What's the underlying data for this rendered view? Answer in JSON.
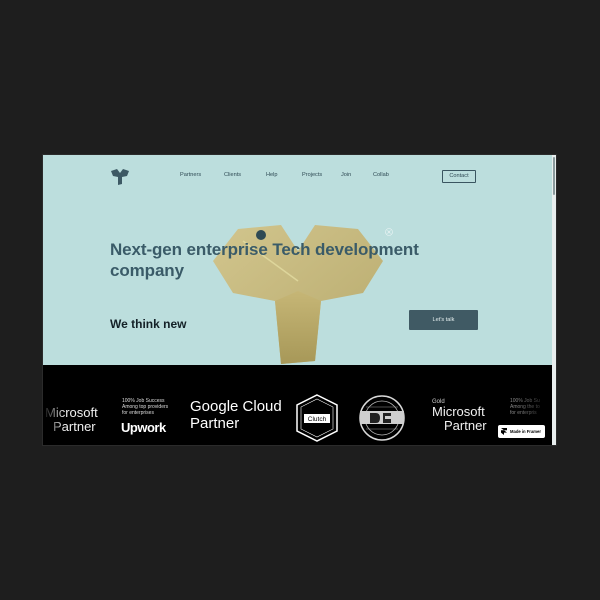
{
  "nav": {
    "items": [
      "Partners",
      "Clients",
      "Help",
      "Projects",
      "Join",
      "Collab"
    ],
    "contact_label": "Contact"
  },
  "hero": {
    "headline": "Next-gen enterprise Tech development company",
    "tagline": "We think new",
    "cta_label": "Let's talk"
  },
  "partners": {
    "ms_left_line1": "Microsoft",
    "ms_left_line2": "Partner",
    "upwork_text": [
      "100% Job Success",
      "Among top providers",
      "for enterprises"
    ],
    "upwork_logo": "Upwork",
    "google_line1": "Google Cloud",
    "google_line2": "Partner",
    "clutch_label": "Clutch",
    "ms_right_gold": "Gold",
    "ms_right_line1": "Microsoft",
    "ms_right_line2": "Partner",
    "upwork_right_text": [
      "100% Job Su",
      "Among the to",
      "for enterpris"
    ]
  },
  "framer_badge": "Made in Framer",
  "colors": {
    "hero_bg": "#bcdedd",
    "headline": "#3a5b68",
    "button_bg": "#405a64",
    "strip_bg": "#000000",
    "page_bg": "#1e1e1e"
  }
}
